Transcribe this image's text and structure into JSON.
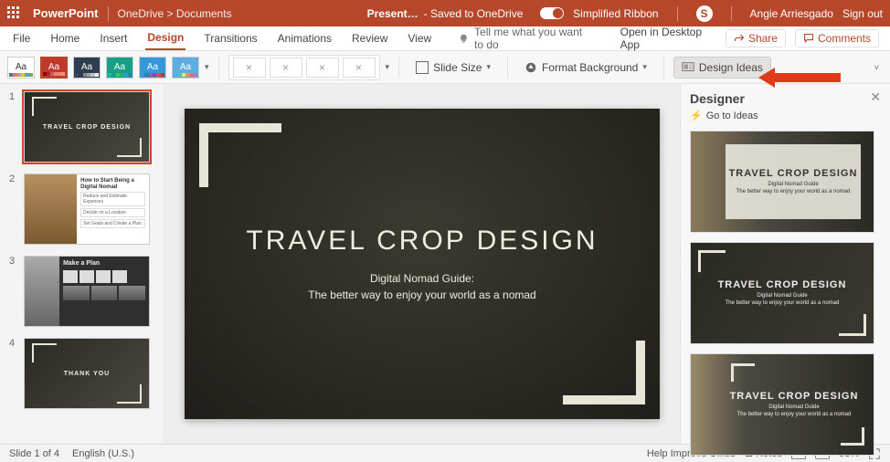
{
  "titlebar": {
    "app": "PowerPoint",
    "path": "OneDrive > Documents",
    "filename": "Present…",
    "saved": "- Saved to OneDrive",
    "simplified": "Simplified Ribbon",
    "user": "Angie Arriesgado",
    "signout": "Sign out"
  },
  "tabs": {
    "items": [
      "File",
      "Home",
      "Insert",
      "Design",
      "Transitions",
      "Animations",
      "Review",
      "View"
    ],
    "active_index": 3,
    "tellme": "Tell me what you want to do",
    "open_desktop": "Open in Desktop App",
    "share": "Share",
    "comments": "Comments"
  },
  "ribbon": {
    "theme_label": "Aa",
    "slide_size": "Slide Size",
    "format_bg": "Format Background",
    "design_ideas": "Design Ideas"
  },
  "slide": {
    "title": "TRAVEL CROP DESIGN",
    "subtitle1": "Digital Nomad Guide:",
    "subtitle2": "The better way to enjoy your world as a nomad"
  },
  "thumbs": {
    "s1_title": "TRAVEL CROP DESIGN",
    "s2_heading": "How to Start Being a Digital Nomad",
    "s2_items": [
      "Reduce and Estimate Expenses",
      "Decide on a Location",
      "Set Goals and Create a Plan"
    ],
    "s3_heading": "Make a Plan",
    "s4_title": "THANK YOU"
  },
  "designer": {
    "header": "Designer",
    "goto": "Go to Ideas",
    "card_title": "TRAVEL CROP DESIGN",
    "card_sub1": "Digital Nomad Guide",
    "card_sub2": "The better way to enjoy your world as a nomad"
  },
  "status": {
    "slide": "Slide 1 of 4",
    "lang": "English (U.S.)",
    "help": "Help Improve Office",
    "notes": "Notes",
    "zoom": "53%"
  }
}
